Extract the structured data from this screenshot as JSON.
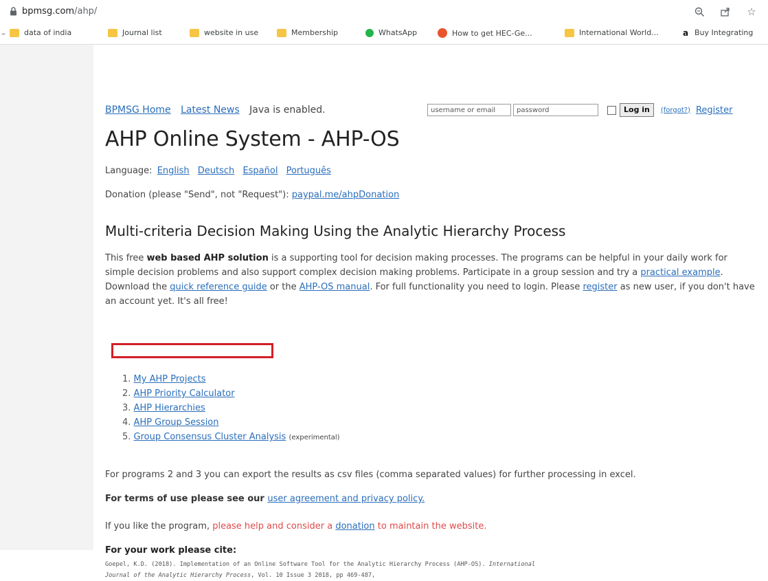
{
  "browser": {
    "url_host": "bpmsg.com",
    "url_path": "/ahp/",
    "bookmarks": [
      {
        "label": "data of india",
        "icon": "folder-icon"
      },
      {
        "label": "Journal list",
        "icon": "folder-icon"
      },
      {
        "label": "website in use",
        "icon": "folder-icon"
      },
      {
        "label": "Membership",
        "icon": "folder-icon"
      },
      {
        "label": "WhatsApp",
        "icon": "whatsapp-icon"
      },
      {
        "label": "How to get HEC-Ge...",
        "icon": "site-icon"
      },
      {
        "label": "International World...",
        "icon": "folder-icon"
      },
      {
        "label": "Buy Integrating",
        "icon": "amazon-icon"
      }
    ]
  },
  "topnav": {
    "home": "BPMSG Home",
    "news": "Latest News",
    "java": "Java is enabled."
  },
  "login": {
    "username_placeholder": "username or email",
    "password_placeholder": "password",
    "login_label": "Log in",
    "forgot_label": "(forgot?)",
    "register_label": "Register"
  },
  "title": "AHP Online System - AHP-OS",
  "language": {
    "prefix": "Language:",
    "options": [
      "English",
      "Deutsch",
      "Español",
      "Português"
    ]
  },
  "donation": {
    "text": "Donation (please \"Send\", not \"Request\"):",
    "link": "paypal.me/ahpDonation"
  },
  "subtitle": "Multi-criteria Decision Making Using the Analytic Hierarchy Process",
  "intro": {
    "t1": "This free ",
    "bold": "web based AHP solution",
    "t2": " is a supporting tool for decision making processes. The programs can be helpful in your daily work for simple decision problems and also support complex decision making problems. Participate in a group session and try a ",
    "link1": "practical example",
    "t3": ". Download the ",
    "link2": "quick reference guide",
    "t4": " or the ",
    "link3": "AHP-OS manual",
    "t5": ". For full functionality you need to login. Please ",
    "link4": "register",
    "t6": " as new user, if you don't have an account yet. It's all free!"
  },
  "programs": [
    {
      "num": "1.",
      "label": "My AHP Projects"
    },
    {
      "num": "2.",
      "label": "AHP Priority Calculator"
    },
    {
      "num": "3.",
      "label": "AHP Hierarchies"
    },
    {
      "num": "4.",
      "label": "AHP Group Session"
    },
    {
      "num": "5.",
      "label": "Group Consensus Cluster Analysis",
      "note": "(experimental)"
    }
  ],
  "export_note": "For programs 2 and 3 you can export the results as csv files (comma separated values) for further processing in excel.",
  "terms": {
    "text": "For terms of use please see our ",
    "link": "user agreement and privacy policy."
  },
  "help": {
    "t1": "If you like the program, ",
    "red1": "please help and consider a ",
    "link": "donation",
    "red2": " to maintain the website."
  },
  "cite": {
    "heading": "For your work please cite:",
    "line1a": "Goepel, K.D. (2018). Implementation of an Online Software Tool for the Analytic Hierarchy Process (AHP-OS). ",
    "line1b": "International",
    "line2a": "Journal of the Analytic Hierarchy Process",
    "line2b": ", Vol. 10 Issue 3 2018, pp 469-487,"
  },
  "colors": {
    "link": "#2a6ebb",
    "highlight": "#d21f26",
    "red_text": "#e04a4a"
  }
}
